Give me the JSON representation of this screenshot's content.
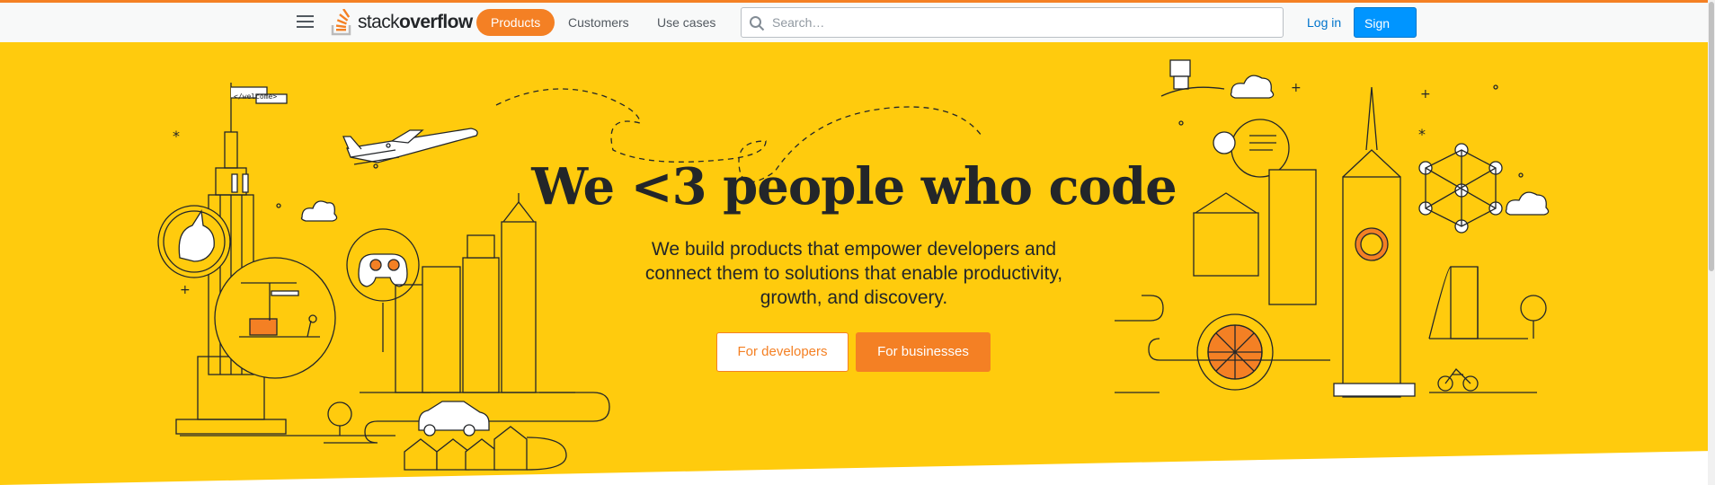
{
  "header": {
    "logo_prefix": "stack",
    "logo_suffix": "overflow",
    "nav": {
      "products": "Products",
      "customers": "Customers",
      "use_cases": "Use cases"
    },
    "search": {
      "placeholder": "Search…"
    },
    "login": "Log in",
    "signup": "Sign up"
  },
  "hero": {
    "title": "We <3 people who code",
    "subtitle": "We build products that empower developers and connect them to solutions that enable productivity, growth, and discovery.",
    "btn_developers": "For developers",
    "btn_businesses": "For businesses",
    "flag_text": "</welcome>"
  },
  "colors": {
    "hero_bg": "#ffcb0d",
    "brand_orange": "#f48024",
    "signup_blue": "#0095ff",
    "text_dark": "#232629"
  },
  "icons": [
    "menu-icon",
    "stackoverflow-logo-icon",
    "search-icon"
  ]
}
